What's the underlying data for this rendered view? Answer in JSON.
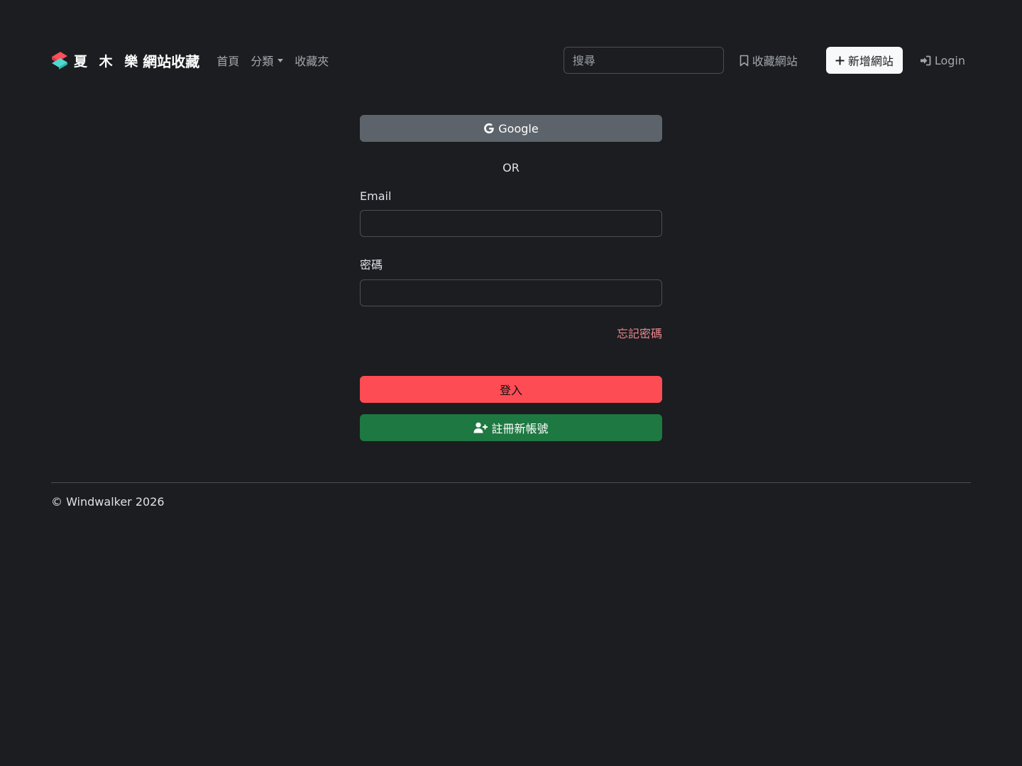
{
  "navbar": {
    "brand_name": "夏 木 樂",
    "brand_subtitle": "網站收藏",
    "links": {
      "home": "首頁",
      "categories": "分類",
      "favorites": "收藏夾"
    },
    "search_placeholder": "搜尋",
    "bookmark_label": "收藏網站",
    "add_site_label": "新增網站",
    "login_label": "Login"
  },
  "form": {
    "google_label": "Google",
    "or_label": "OR",
    "email_label": "Email",
    "email_value": "",
    "password_label": "密碼",
    "password_value": "",
    "forgot_label": "忘記密碼",
    "login_button_label": "登入",
    "register_button_label": "註冊新帳號"
  },
  "footer": {
    "copyright": "© Windwalker 2026"
  },
  "colors": {
    "background": "#1b1d20",
    "primary": "#fe4c55",
    "success": "#1e7841",
    "secondary": "#5c636a",
    "link_danger": "#ea868f"
  }
}
